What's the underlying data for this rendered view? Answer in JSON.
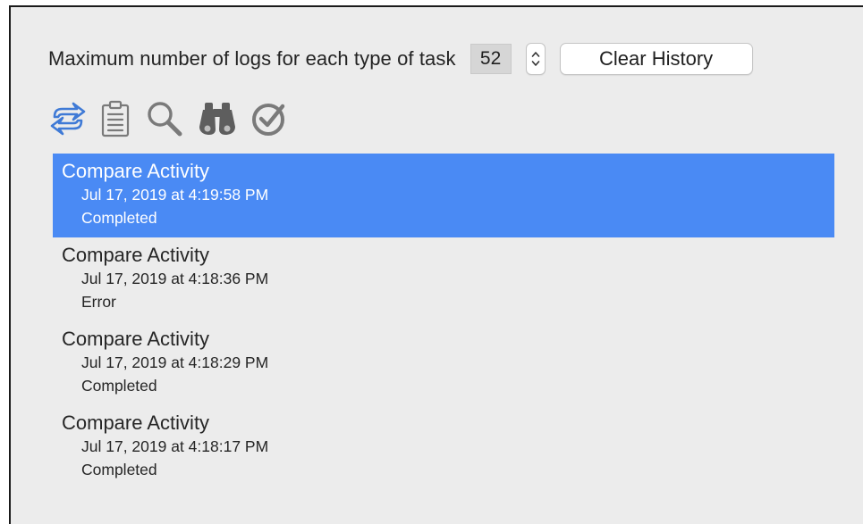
{
  "settings": {
    "max_logs_label": "Maximum number of logs for each type of task",
    "max_logs_value": "52",
    "clear_history_label": "Clear History"
  },
  "toolbar": {
    "icons": [
      "compare-arrows-icon",
      "clipboard-icon",
      "magnifier-icon",
      "binoculars-icon",
      "checkmark-circle-icon"
    ],
    "accent_color": "#3f7ad6",
    "icon_color": "#7a7a7a"
  },
  "logs": [
    {
      "title": "Compare Activity",
      "date": "Jul 17, 2019 at 4:19:58 PM",
      "status": "Completed",
      "selected": true
    },
    {
      "title": "Compare Activity",
      "date": "Jul 17, 2019 at 4:18:36 PM",
      "status": "Error",
      "selected": false
    },
    {
      "title": "Compare Activity",
      "date": "Jul 17, 2019 at 4:18:29 PM",
      "status": "Completed",
      "selected": false
    },
    {
      "title": "Compare Activity",
      "date": "Jul 17, 2019 at 4:18:17 PM",
      "status": "Completed",
      "selected": false
    }
  ],
  "colors": {
    "selection": "#4a8af4",
    "window_bg": "#ececec"
  }
}
